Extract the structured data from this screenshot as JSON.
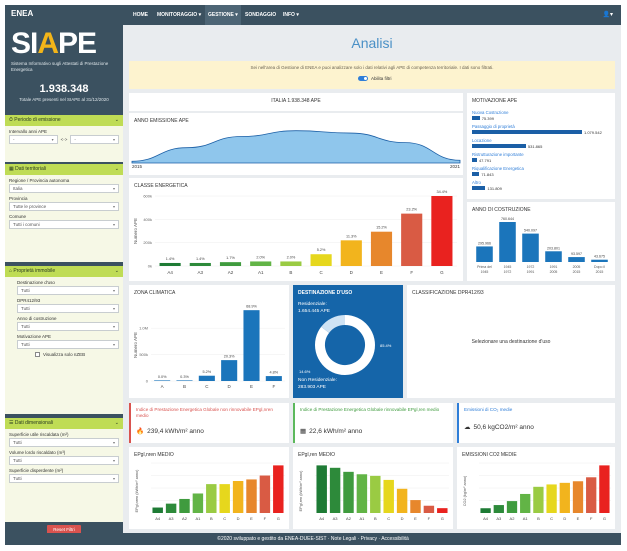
{
  "brand": {
    "logo_top": "ENEA",
    "logo_main_pre": "SI",
    "logo_main_a": "A",
    "logo_main_post": "PE",
    "subtitle": "Sistema Informativo sugli Attestati di Prestazione Energetica"
  },
  "kpi": {
    "total": "1.938.348",
    "caption": "Totale APE presenti nel SIAPE al 31/12/2020"
  },
  "filters": {
    "periodo": {
      "header": "Periodo di emissione",
      "label": "Intervallo anni APE",
      "from": "-",
      "sep": "<->",
      "to": "-"
    },
    "territoriali": {
      "header": "Dati territoriali",
      "regione_label": "Regione / Provincia autonoma",
      "regione_value": "Italia",
      "provincia_label": "Provincia",
      "provincia_value": "Tutte le province",
      "comune_label": "Comune",
      "comune_value": "Tutti i comuni"
    },
    "immobile": {
      "header": "Proprietà immobile",
      "dest_label": "Destinazione d'uso",
      "dest_value": "Tutti",
      "dpr_label": "DPR412/93",
      "dpr_value": "Tutti",
      "anno_label": "Anno di costruzione",
      "anno_value": "Tutti",
      "mot_label": "Motivazione APE",
      "mot_value": "Tutti",
      "nzeb_label": "Visualizza solo nZEB"
    },
    "dimensionali": {
      "header": "Dati dimensionali",
      "sup_label": "Superficie utile riscaldata (m²)",
      "sup_value": "Tutti",
      "vol_label": "Volume lordo riscaldato (m³)",
      "vol_value": "Tutti",
      "disp_label": "Superficie disperdente (m²)",
      "disp_value": "Tutti"
    },
    "reset": "Reset Filtri"
  },
  "nav": {
    "items": [
      "HOME",
      "MONITORAGGIO",
      "GESTIONE",
      "SONDAGGIO",
      "INFO"
    ],
    "active": "GESTIONE"
  },
  "page": {
    "title": "Analisi"
  },
  "notice": {
    "text": "Sei nell'area di Gestione di ENEA e puoi analizzare solo i dati relativi agli APE di competenza territoriale. I dati sono filtrati.",
    "toggle": "Abilita filtri"
  },
  "italia": {
    "title": "ITALIA 1.938.348 APE"
  },
  "anno_emissione": {
    "title": "ANNO EMISSIONE APE",
    "start": "2015",
    "end": "2021"
  },
  "classe_energetica": {
    "title": "CLASSE ENERGETICA",
    "ylabel": "Numero APE",
    "ticks": [
      "600k",
      "400k",
      "200k",
      "0k"
    ]
  },
  "motivazione": {
    "title": "MOTIVAZIONE APE",
    "items": [
      {
        "label": "Nuova Costruzione",
        "value": "75.399",
        "frac": 0.07
      },
      {
        "label": "Passaggio di proprietà",
        "value": "1.079.542",
        "frac": 1.0
      },
      {
        "label": "Locazione",
        "value": "531.865",
        "frac": 0.49
      },
      {
        "label": "Ristrutturazione importante",
        "value": "47.791",
        "frac": 0.045
      },
      {
        "label": "Riqualificazione Energetica",
        "value": "71.843",
        "frac": 0.067
      },
      {
        "label": "Altro",
        "value": "131.809",
        "frac": 0.122
      }
    ]
  },
  "anno_costruzione": {
    "title": "ANNO DI COSTRUZIONE"
  },
  "zona_climatica": {
    "title": "ZONA CLIMATICA",
    "ylabel": "Numero APE",
    "ticks": [
      "1.0M",
      "500k",
      "0"
    ]
  },
  "destinazione": {
    "title": "DESTINAZIONE D'USO",
    "res_label": "Residenziale:",
    "res_value": "1.654.445 APE",
    "nonres_label": "Non Residenziale:",
    "nonres_value": "283.903 APE",
    "pct_res": "85.4%",
    "pct_nonres": "14.6%"
  },
  "dpr": {
    "title": "CLASSIFICAZIONE DPR412/93",
    "message": "Selezionare una destinazione d'uso"
  },
  "ind_nren": {
    "title": "Indice di Prestazione Energetica Globale non rinnovabile EPgl,nren medio",
    "value": "239,4 kWh/m² anno",
    "color": "#d9534f"
  },
  "ind_ren": {
    "title": "Indice di Prestazione Energetica Globale rinnovabile EPgl,ren medio",
    "value": "22,6 kWh/m² anno",
    "color": "#5cb85c"
  },
  "ind_co2": {
    "title": "Emissioni di CO₂ medie",
    "value": "50,6 kgCO2/m² anno",
    "color": "#2f7ed8"
  },
  "ep_nren_medio": {
    "title": "EPgl,nren MEDIO",
    "ylabel": "EPgl,nren (kWh/m² anno)"
  },
  "ep_ren_medio": {
    "title": "EPgl,ren MEDIO",
    "ylabel": "EPgl,ren (kWh/m² anno)"
  },
  "co2_medie": {
    "title": "EMISSIONI CO2 MEDIE",
    "ylabel": "CO2 (kg/m² anno)"
  },
  "footer": {
    "text": "©2020 sviluppato e gestito da ENEA-DUEE-SIST · Note Legali · Privacy · Accessibilità"
  },
  "chart_data": [
    {
      "type": "area",
      "title": "ANNO EMISSIONE APE",
      "x": [
        "2015",
        "2016",
        "2017",
        "2018",
        "2019",
        "2020",
        "2021"
      ],
      "values": [
        0.05,
        0.45,
        0.78,
        0.95,
        0.88,
        0.6,
        0.08
      ]
    },
    {
      "type": "bar",
      "title": "CLASSE ENERGETICA",
      "ylabel": "Numero APE",
      "ylim": [
        0,
        600000
      ],
      "categories": [
        "A4",
        "A3",
        "A2",
        "A1",
        "B",
        "C",
        "D",
        "E",
        "F",
        "G"
      ],
      "values": [
        26000,
        26000,
        33000,
        39000,
        39000,
        101000,
        220000,
        294000,
        449000,
        628000
      ],
      "labels": [
        "1.4%",
        "1.4%",
        "1.7%",
        "2.0%",
        "2.0%",
        "5.2%",
        "11.3%",
        "15.2%",
        "23.2%",
        "34.4%"
      ],
      "colors": [
        "#1e7b35",
        "#2d8a3a",
        "#3f9b3e",
        "#62b446",
        "#9acb43",
        "#e6d71d",
        "#f2b41d",
        "#e7872c",
        "#d95b44",
        "#e9221f"
      ]
    },
    {
      "type": "bar",
      "title": "ANNO DI COSTRUZIONE",
      "categories": [
        "Prima del 1945",
        "1945 1972",
        "1972 1991",
        "1991 2005",
        "2005 2015",
        "Dopo il 2015"
      ],
      "values": [
        295966,
        760644,
        540097,
        203801,
        93597,
        43675
      ],
      "labels": [
        "295.966",
        "760.644",
        "540.097",
        "203.801",
        "93.597",
        "43.675"
      ]
    },
    {
      "type": "bar",
      "title": "ZONA CLIMATICA",
      "ylabel": "Numero APE",
      "ylim": [
        0,
        1000000
      ],
      "categories": [
        "A",
        "B",
        "C",
        "D",
        "E",
        "F"
      ],
      "values": [
        0,
        5800,
        100000,
        395000,
        1340000,
        93000
      ],
      "labels": [
        "0.0%",
        "0.3%",
        "5.2%",
        "20.3%",
        "68.9%",
        "4.8%"
      ]
    },
    {
      "type": "pie",
      "title": "DESTINAZIONE D'USO",
      "categories": [
        "Residenziale",
        "Non Residenziale"
      ],
      "values": [
        85.4,
        14.6
      ]
    },
    {
      "type": "bar",
      "title": "EPgl,nren MEDIO",
      "categories": [
        "A4",
        "A3",
        "A2",
        "A1",
        "B",
        "C",
        "D",
        "E",
        "F",
        "G"
      ],
      "values": [
        7,
        12,
        18,
        25,
        37,
        37,
        41,
        43,
        48,
        61
      ]
    },
    {
      "type": "bar",
      "title": "EPgl,ren MEDIO",
      "categories": [
        "A4",
        "A3",
        "A2",
        "A1",
        "B",
        "C",
        "D",
        "E",
        "F",
        "G"
      ],
      "values": [
        59,
        56,
        51,
        48,
        46,
        41,
        30,
        16,
        9,
        6
      ]
    },
    {
      "type": "bar",
      "title": "EMISSIONI CO2 MEDIE",
      "categories": [
        "A4",
        "A3",
        "A2",
        "A1",
        "B",
        "C",
        "D",
        "E",
        "F",
        "G"
      ],
      "values": [
        6,
        10,
        15,
        24,
        33,
        36,
        38,
        40,
        45,
        60
      ]
    }
  ]
}
